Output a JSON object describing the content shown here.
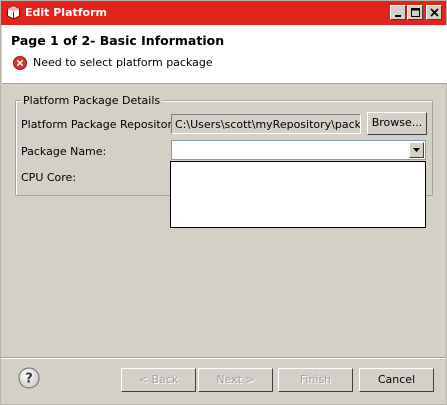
{
  "window": {
    "title": "Edit Platform"
  },
  "header": {
    "page_title": "Page 1 of 2- Basic Information",
    "error_message": "Need to select platform package"
  },
  "form": {
    "group_title": "Platform Package Details",
    "repository_label": "Platform Package Repository:",
    "repository_value": "C:\\Users\\scott\\myRepository\\package",
    "browse_label": "Browse...",
    "package_name_label": "Package Name:",
    "package_name_value": "",
    "cpu_core_label": "CPU Core:"
  },
  "buttons": {
    "back": "< Back",
    "next": "Next >",
    "finish": "Finish",
    "cancel": "Cancel"
  },
  "icons": {
    "app": "platform-cube-icon",
    "error": "error-icon",
    "help": "help-icon"
  },
  "colors": {
    "titlebar": "#e4241c",
    "error": "#d9342b"
  }
}
